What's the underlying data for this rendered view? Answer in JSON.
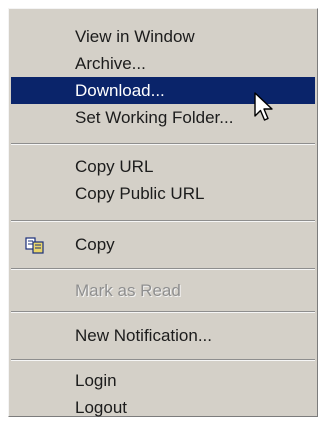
{
  "menu": {
    "items": [
      {
        "label": "View in Window"
      },
      {
        "label": "Archive..."
      },
      {
        "label": "Download..."
      },
      {
        "label": "Set Working Folder..."
      },
      {
        "label": "Copy URL"
      },
      {
        "label": "Copy Public URL"
      },
      {
        "label": "Copy",
        "icon": "copy-icon"
      },
      {
        "label": "Mark as Read",
        "disabled": true
      },
      {
        "label": "New Notification..."
      },
      {
        "label": "Login"
      },
      {
        "label": "Logout"
      }
    ]
  },
  "colors": {
    "menu_bg": "#d4d0c8",
    "highlight_bg": "#0a246a",
    "highlight_text": "#ffffff",
    "text": "#1c1c1c",
    "disabled_text": "#8f8f8f"
  },
  "icons": {
    "cursor": "arrow-cursor-icon"
  }
}
